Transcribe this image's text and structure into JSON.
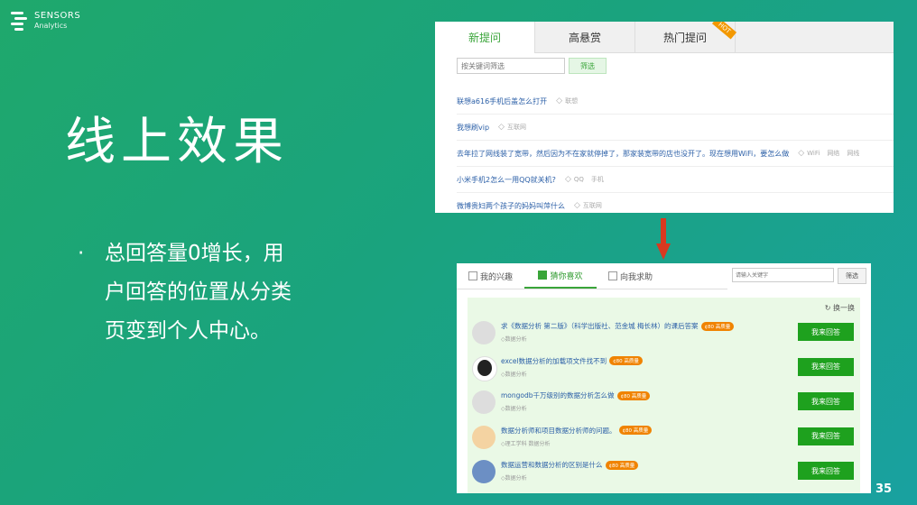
{
  "brand": {
    "line1": "SENSORS",
    "line2": "Analytics"
  },
  "slide": {
    "title": "线上效果",
    "bullet_dot": "·",
    "bullet_text": "总回答量0增长，用户回答的位置从分类页变到个人中心。",
    "page_number": "35"
  },
  "old_ui": {
    "tabs": [
      {
        "label": "新提问",
        "active": true
      },
      {
        "label": "高悬赏",
        "active": false
      },
      {
        "label": "热门提问",
        "active": false,
        "badge": "HOT"
      }
    ],
    "search": {
      "placeholder": "按关键词筛选",
      "button": "筛选"
    },
    "questions": [
      {
        "title": "联想a616手机后盖怎么打开",
        "tags": [
          "联想"
        ]
      },
      {
        "title": "我想刷vip",
        "tags": [
          "互联网"
        ]
      },
      {
        "title": "去年拉了网线装了宽带，然后因为不在家就停掉了，那家装宽带的店也没开了。现在想用WiFi，要怎么做",
        "tags": [
          "WiFi",
          "网络",
          "网线"
        ]
      },
      {
        "title": "小米手机2怎么一用QQ就关机?",
        "tags": [
          "QQ",
          "手机"
        ]
      },
      {
        "title": "微博贵妇两个孩子的妈妈叫萍什么",
        "tags": [
          "互联网"
        ]
      }
    ]
  },
  "new_ui": {
    "tabs": [
      {
        "label": "我的兴趣",
        "active": false
      },
      {
        "label": "猜你喜欢",
        "active": true
      },
      {
        "label": "向我求助",
        "active": false
      }
    ],
    "search": {
      "placeholder": "请输入关键字",
      "button": "筛选"
    },
    "refresh_label": "换一换",
    "answer_label": "我来回答",
    "items": [
      {
        "title": "求《数据分析 第二版》（科学出版社、范金城 梅长林）的课后答案",
        "badge": "¢80 高质量",
        "tags": "数据分析",
        "avatar": "default"
      },
      {
        "title": "excel数据分析的加载项文件找不到",
        "badge": "¢80 高质量",
        "tags": "数据分析",
        "avatar": "face-dark"
      },
      {
        "title": "mongodb千万级别的数据分析怎么做",
        "badge": "¢80 高质量",
        "tags": "数据分析",
        "avatar": "default"
      },
      {
        "title": "数据分析师和项目数据分析师的问题。",
        "badge": "¢80 高质量",
        "tags": "理工学科  数据分析",
        "avatar": "cartoon"
      },
      {
        "title": "数据运营和数据分析的区别是什么",
        "badge": "¢80 高质量",
        "tags": "数据分析",
        "avatar": "blue"
      }
    ]
  },
  "colors": {
    "accent_green": "#3aa53a",
    "answer_button": "#1ea11e",
    "badge_orange": "#f08300",
    "arrow_red": "#d9391f"
  }
}
